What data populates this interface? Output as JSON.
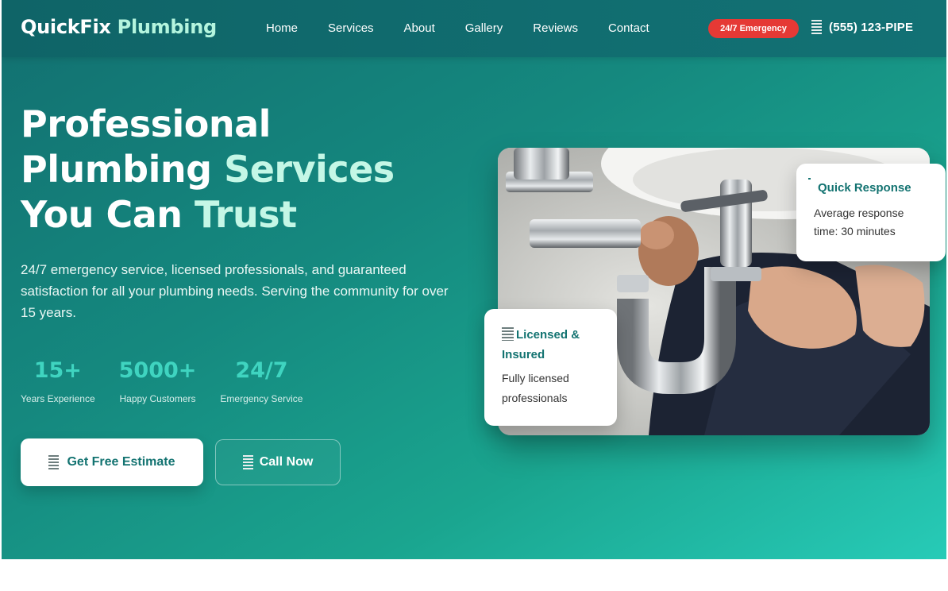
{
  "nav": {
    "brand_part1": "QuickFix",
    "brand_part2": "Plumbing",
    "links": [
      "Home",
      "Services",
      "About",
      "Gallery",
      "Reviews",
      "Contact"
    ],
    "emergency_badge": "24/7 Emergency",
    "phone": "(555) 123-PIPE",
    "phone_icon": "phone-icon"
  },
  "hero": {
    "title_line1": "Professional",
    "title_line2_a": "Plumbing",
    "title_line2_b": "Services",
    "title_line3_a": "You Can",
    "title_line3_b": "Trust",
    "description": "24/7 emergency service, licensed professionals, and guaranteed satisfaction for all your plumbing needs. Serving the community for over 15 years.",
    "stats": [
      {
        "value": "15+",
        "label": "Years Experience"
      },
      {
        "value": "5000+",
        "label": "Happy Customers"
      },
      {
        "value": "24/7",
        "label": "Emergency Service"
      }
    ],
    "primary_button": "Get Free Estimate",
    "secondary_button": "Call Now"
  },
  "cards": {
    "quick_title": "Quick Response",
    "quick_desc": "Average response time: 30 minutes",
    "licensed_title": "Licensed & Insured",
    "licensed_desc": "Fully licensed professionals"
  },
  "colors": {
    "brand_teal": "#137371",
    "mint_accent": "#c4f7e6",
    "stat_accent": "#3fd4c0",
    "emergency_red": "#e53935"
  }
}
